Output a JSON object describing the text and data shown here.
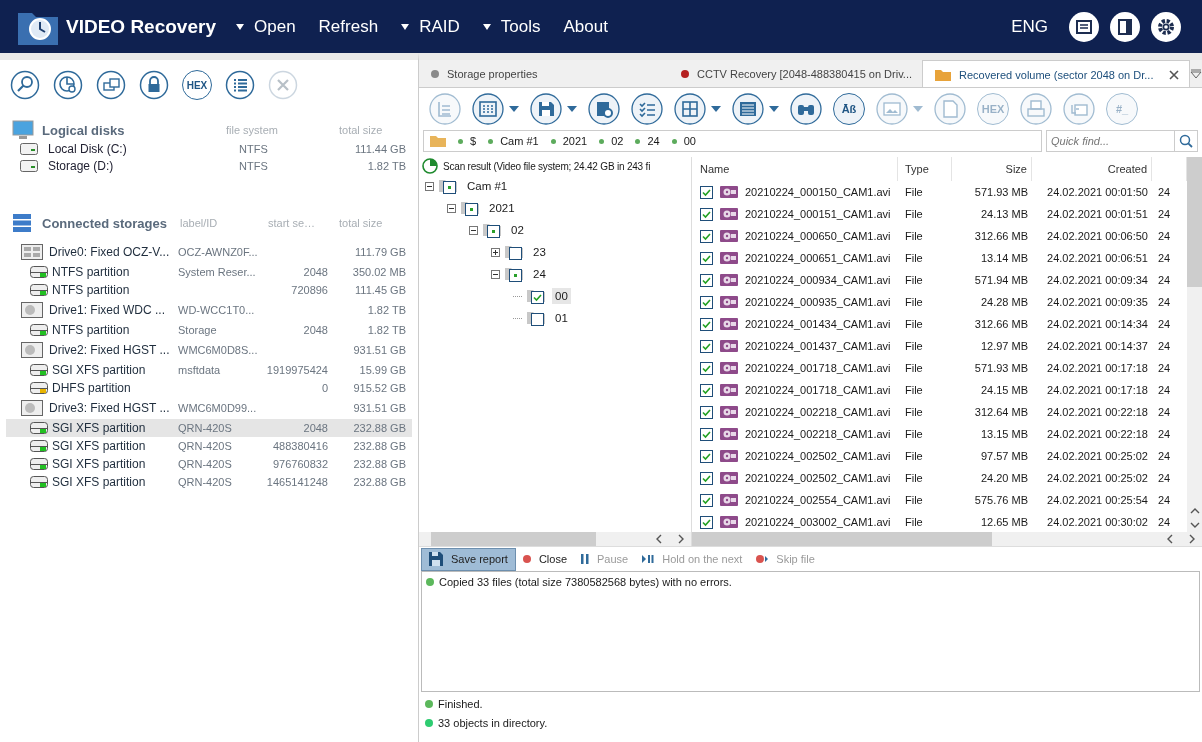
{
  "app": {
    "title": "VIDEO Recovery",
    "language": "ENG",
    "menu": [
      {
        "label": "Open",
        "dropdown": true
      },
      {
        "label": "Refresh",
        "dropdown": false
      },
      {
        "label": "RAID",
        "dropdown": true
      },
      {
        "label": "Tools",
        "dropdown": true
      },
      {
        "label": "About",
        "dropdown": false
      }
    ]
  },
  "left_toolbar": [
    {
      "kind": "search",
      "disabled": false
    },
    {
      "kind": "chart",
      "disabled": false
    },
    {
      "kind": "disks",
      "disabled": false
    },
    {
      "kind": "lock",
      "disabled": false
    },
    {
      "kind": "hex",
      "label": "HEX",
      "disabled": false
    },
    {
      "kind": "list",
      "disabled": false
    },
    {
      "kind": "close",
      "disabled": true
    }
  ],
  "logical_disks": {
    "title": "Logical disks",
    "columns": [
      "file system",
      "total size"
    ],
    "items": [
      {
        "name": "Local Disk (C:)",
        "file_system": "NTFS",
        "size": "111.44 GB"
      },
      {
        "name": "Storage (D:)",
        "file_system": "NTFS",
        "size": "1.82 TB"
      }
    ]
  },
  "connected_storages": {
    "title": "Connected storages",
    "columns": [
      "label/ID",
      "start se…",
      "total size"
    ],
    "drives": [
      {
        "kind": "ssd",
        "name": "Drive0: Fixed OCZ-V...",
        "label": "OCZ-AWNZ0F...",
        "size": "111.79 GB",
        "partitions": [
          {
            "name": "NTFS partition",
            "label": "System Reser...",
            "start": "2048",
            "size": "350.02 MB",
            "color": "#22c022",
            "selected": false
          },
          {
            "name": "NTFS partition",
            "start": "720896",
            "size": "111.45 GB",
            "color": "#22c022",
            "selected": false
          }
        ]
      },
      {
        "kind": "hdd",
        "name": "Drive1: Fixed WDC ...",
        "label": "WD-WCC1T0...",
        "size": "1.82 TB",
        "partitions": [
          {
            "name": "NTFS partition",
            "label": "Storage",
            "start": "2048",
            "size": "1.82 TB",
            "color": "#22c022",
            "selected": false
          }
        ]
      },
      {
        "kind": "hdd",
        "name": "Drive2: Fixed HGST ...",
        "label": "WMC6M0D8S...",
        "size": "931.51 GB",
        "partitions": [
          {
            "name": "SGI XFS partition",
            "label": "msftdata",
            "start": "1919975424",
            "size": "15.99 GB",
            "color": "#22c022",
            "selected": false
          },
          {
            "name": "DHFS partition",
            "start": "0",
            "size": "915.52 GB",
            "color": "#e8b400",
            "selected": false
          }
        ]
      },
      {
        "kind": "hdd",
        "name": "Drive3: Fixed HGST ...",
        "label": "WMC6M0D99...",
        "size": "931.51 GB",
        "partitions": [
          {
            "name": "SGI XFS partition",
            "label": "QRN-420S",
            "start": "2048",
            "size": "232.88 GB",
            "color": "#22c022",
            "selected": true
          },
          {
            "name": "SGI XFS partition",
            "label": "QRN-420S",
            "start": "488380416",
            "size": "232.88 GB",
            "color": "#22c022",
            "selected": false
          },
          {
            "name": "SGI XFS partition",
            "label": "QRN-420S",
            "start": "976760832",
            "size": "232.88 GB",
            "color": "#22c022",
            "selected": false
          },
          {
            "name": "SGI XFS partition",
            "label": "QRN-420S",
            "start": "1465141248",
            "size": "232.88 GB",
            "color": "#22c022",
            "selected": false
          }
        ]
      }
    ]
  },
  "tabs": [
    {
      "kind": "dot",
      "color": "#8a8a8a",
      "label": "Storage properties",
      "selected": false,
      "closable": false
    },
    {
      "kind": "dot",
      "color": "#b52020",
      "label": "CCTV Recovery [2048-488380415 on Driv...",
      "selected": false,
      "closable": false
    },
    {
      "kind": "folder",
      "label": "Recovered volume (sector 2048 on Dr...",
      "selected": true,
      "closable": true
    }
  ],
  "toolbar": [
    {
      "kind": "tree",
      "dropdown": false,
      "disabled": true
    },
    {
      "kind": "grid",
      "dropdown": true,
      "disabled": false
    },
    {
      "kind": "save",
      "dropdown": true,
      "disabled": false
    },
    {
      "kind": "save-settings",
      "dropdown": false,
      "disabled": false
    },
    {
      "kind": "checklist",
      "dropdown": false,
      "disabled": false
    },
    {
      "kind": "table",
      "dropdown": true,
      "disabled": false
    },
    {
      "kind": "rows",
      "dropdown": true,
      "disabled": false
    },
    {
      "kind": "binoculars",
      "dropdown": false,
      "disabled": false
    },
    {
      "kind": "text",
      "label": "Āß",
      "dropdown": false,
      "disabled": false
    },
    {
      "kind": "image",
      "dropdown": true,
      "disabled": true
    },
    {
      "kind": "file",
      "dropdown": false,
      "disabled": true
    },
    {
      "kind": "text",
      "label": "HEX",
      "dropdown": false,
      "disabled": true
    },
    {
      "kind": "print",
      "dropdown": false,
      "disabled": true
    },
    {
      "kind": "export",
      "dropdown": false,
      "disabled": true
    },
    {
      "kind": "text",
      "label": "#_",
      "dropdown": false,
      "disabled": true
    }
  ],
  "path": [
    "$",
    "Cam #1",
    "2021",
    "02",
    "24",
    "00"
  ],
  "quick_find": {
    "placeholder": "Quick find..."
  },
  "tree": {
    "title": "Scan result (Video file system; 24.42 GB in 243 fi",
    "nodes": [
      {
        "label": "Cam #1",
        "checked": false,
        "partial": true,
        "expanded": true,
        "selected": false,
        "children": [
          {
            "label": "2021",
            "checked": false,
            "partial": true,
            "expanded": true,
            "selected": false,
            "children": [
              {
                "label": "02",
                "checked": false,
                "partial": true,
                "expanded": true,
                "selected": false,
                "children": [
                  {
                    "label": "23",
                    "checked": false,
                    "partial": false,
                    "expanded": false,
                    "selected": false
                  },
                  {
                    "label": "24",
                    "checked": false,
                    "partial": true,
                    "expanded": true,
                    "selected": false,
                    "children": [
                      {
                        "label": "00",
                        "checked": true,
                        "partial": false,
                        "selected": true
                      },
                      {
                        "label": "01",
                        "checked": false,
                        "partial": false,
                        "selected": false
                      }
                    ]
                  }
                ]
              }
            ]
          }
        ]
      }
    ]
  },
  "files": {
    "columns": [
      "Name",
      "Type",
      "Size",
      "Created"
    ],
    "rows": [
      {
        "checked": true,
        "name": "20210224_000150_CAM1.avi",
        "type": "File",
        "size": "571.93 MB",
        "created": "24.02.2021 00:01:50",
        "column_5": "24"
      },
      {
        "checked": true,
        "name": "20210224_000151_CAM1.avi",
        "type": "File",
        "size": "24.13 MB",
        "created": "24.02.2021 00:01:51",
        "column_5": "24"
      },
      {
        "checked": true,
        "name": "20210224_000650_CAM1.avi",
        "type": "File",
        "size": "312.66 MB",
        "created": "24.02.2021 00:06:50",
        "column_5": "24"
      },
      {
        "checked": true,
        "name": "20210224_000651_CAM1.avi",
        "type": "File",
        "size": "13.14 MB",
        "created": "24.02.2021 00:06:51",
        "column_5": "24"
      },
      {
        "checked": true,
        "name": "20210224_000934_CAM1.avi",
        "type": "File",
        "size": "571.94 MB",
        "created": "24.02.2021 00:09:34",
        "column_5": "24"
      },
      {
        "checked": true,
        "name": "20210224_000935_CAM1.avi",
        "type": "File",
        "size": "24.28 MB",
        "created": "24.02.2021 00:09:35",
        "column_5": "24"
      },
      {
        "checked": true,
        "name": "20210224_001434_CAM1.avi",
        "type": "File",
        "size": "312.66 MB",
        "created": "24.02.2021 00:14:34",
        "column_5": "24"
      },
      {
        "checked": true,
        "name": "20210224_001437_CAM1.avi",
        "type": "File",
        "size": "12.97 MB",
        "created": "24.02.2021 00:14:37",
        "column_5": "24"
      },
      {
        "checked": true,
        "name": "20210224_001718_CAM1.avi",
        "type": "File",
        "size": "571.93 MB",
        "created": "24.02.2021 00:17:18",
        "column_5": "24"
      },
      {
        "checked": true,
        "name": "20210224_001718_CAM1.avi",
        "type": "File",
        "size": "24.15 MB",
        "created": "24.02.2021 00:17:18",
        "column_5": "24"
      },
      {
        "checked": true,
        "name": "20210224_002218_CAM1.avi",
        "type": "File",
        "size": "312.64 MB",
        "created": "24.02.2021 00:22:18",
        "column_5": "24"
      },
      {
        "checked": true,
        "name": "20210224_002218_CAM1.avi",
        "type": "File",
        "size": "13.15 MB",
        "created": "24.02.2021 00:22:18",
        "column_5": "24"
      },
      {
        "checked": true,
        "name": "20210224_002502_CAM1.avi",
        "type": "File",
        "size": "97.57 MB",
        "created": "24.02.2021 00:25:02",
        "column_5": "24"
      },
      {
        "checked": true,
        "name": "20210224_002502_CAM1.avi",
        "type": "File",
        "size": "24.20 MB",
        "created": "24.02.2021 00:25:02",
        "column_5": "24"
      },
      {
        "checked": true,
        "name": "20210224_002554_CAM1.avi",
        "type": "File",
        "size": "575.76 MB",
        "created": "24.02.2021 00:25:54",
        "column_5": "24"
      },
      {
        "checked": true,
        "name": "20210224_003002_CAM1.avi",
        "type": "File",
        "size": "12.65 MB",
        "created": "24.02.2021 00:30:02",
        "column_5": "24"
      }
    ]
  },
  "log_toolbar": [
    {
      "kind": "save",
      "label": "Save report",
      "selected": true,
      "disabled": false
    },
    {
      "kind": "stop",
      "label": "Close",
      "selected": false,
      "disabled": false
    },
    {
      "kind": "pause",
      "label": "Pause",
      "selected": false,
      "disabled": true
    },
    {
      "kind": "hold",
      "label": "Hold on the next",
      "selected": false,
      "disabled": true
    },
    {
      "kind": "skip",
      "label": "Skip file",
      "selected": false,
      "disabled": true
    }
  ],
  "log": [
    {
      "text": "Copied 33 files (total size 7380582568 bytes) with no errors.",
      "color": "#5cb85c"
    }
  ],
  "status": [
    {
      "text": "Finished.",
      "color": "#5cb85c"
    },
    {
      "text": "33 objects in directory.",
      "color": "#2ecc71"
    }
  ]
}
